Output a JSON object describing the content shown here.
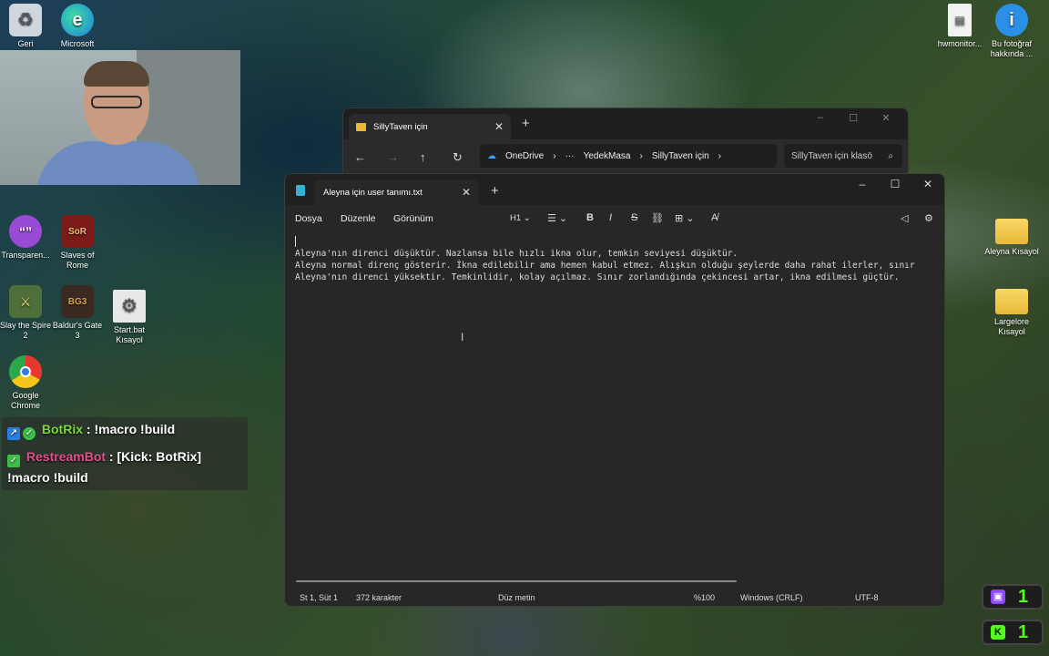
{
  "desktop": {
    "icons_left": [
      {
        "label": "Geri",
        "icon": "recycle-bin-icon",
        "color": "#d0d6dc"
      },
      {
        "label": "Microsoft",
        "icon": "edge-icon",
        "color": "#1f9be0"
      },
      {
        "label": "Transparen...",
        "icon": "chat-bubble-icon",
        "color": "#9a4bd6"
      },
      {
        "label": "Slaves of Rome",
        "icon": "game-icon",
        "color": "#7d1b1b"
      },
      {
        "label": "Slay the Spire 2",
        "icon": "game-icon",
        "color": "#4e6e3a"
      },
      {
        "label": "Baldur's Gate 3",
        "icon": "game-icon",
        "color": "#3b2a22"
      },
      {
        "label": "Start.bat Kısayol",
        "icon": "settings-file-icon",
        "color": "#e8e8e8"
      },
      {
        "label": "Google Chrome",
        "icon": "chrome-icon",
        "color": "#e5382e"
      }
    ],
    "icons_right": [
      {
        "label": "hwmonitor...",
        "icon": "document-icon",
        "color": "#f2f2f2"
      },
      {
        "label": "Bu fotoğraf hakkında ...",
        "icon": "info-icon",
        "color": "#2b8fe6"
      },
      {
        "label": "Aleyna Kısayol",
        "icon": "folder-icon",
        "color": "#f3c543"
      },
      {
        "label": "Largelore Kısayol",
        "icon": "folder-icon",
        "color": "#f3c543"
      }
    ]
  },
  "chat": {
    "line1_user": "BotRix",
    "line1_msg": ": !macro !build",
    "line2_user": "RestreamBot",
    "line2_msg": ": [Kick: BotRix]",
    "line3_msg": "!macro !build",
    "user1_color": "#7cd93a",
    "user2_color": "#e0508a"
  },
  "explorer": {
    "tab_title": "SillyTaven için",
    "breadcrumb": [
      "OneDrive",
      "YedekMasa",
      "SillyTaven için"
    ],
    "search_placeholder": "SillyTaven için klasö"
  },
  "notepad": {
    "tab_title": "Aleyna için user tanımı.txt",
    "menu": [
      "Dosya",
      "Düzenle",
      "Görünüm"
    ],
    "heading_btn": "H1",
    "lines": [
      "Aleyna'nın direnci düşüktür. Nazlansa bile hızlı ikna olur, temkin seviyesi düşüktür.",
      "Aleyna normal direnç gösterir. İkna edilebilir ama hemen kabul etmez. Alışkın olduğu şeylerde daha rahat ilerler, sınır",
      "Aleyna'nın direnci yüksektir. Temkinlidir, kolay açılmaz. Sınır zorlandığında çekincesi artar, ikna edilmesi güçtür."
    ],
    "status": {
      "position": "St 1, Süt 1",
      "chars": "372 karakter",
      "format": "Düz metin",
      "zoom": "%100",
      "line_ending": "Windows (CRLF)",
      "encoding": "UTF-8"
    }
  },
  "viewers": {
    "twitch_count": "1",
    "kick_count": "1",
    "twitch_color": "#9146ff",
    "kick_color": "#53fc18"
  }
}
